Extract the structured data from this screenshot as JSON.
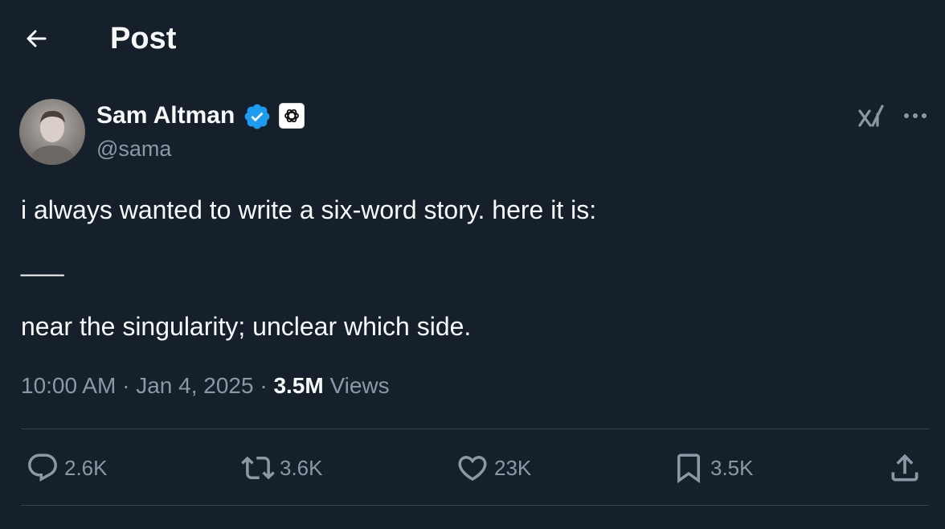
{
  "header": {
    "title": "Post",
    "back_icon": "arrow-left-icon"
  },
  "author": {
    "display_name": "Sam Altman",
    "handle": "@sama",
    "verified_icon": "verified-badge-icon",
    "affiliate_icon": "openai-logo-icon",
    "colors": {
      "verified": "#1d9bf0"
    }
  },
  "toolbar": {
    "grok_icon": "grok-icon",
    "more_icon": "more-horizontal-icon"
  },
  "post": {
    "line1": "i always wanted to write a six-word story. here it is:",
    "line2": "___",
    "line3": "near the singularity; unclear which side."
  },
  "meta": {
    "time": "10:00 AM",
    "sep1": " · ",
    "date": "Jan 4, 2025",
    "sep2": " · ",
    "views_count": "3.5M",
    "views_label": " Views"
  },
  "actions": {
    "replies": "2.6K",
    "reposts": "3.6K",
    "likes": "23K",
    "bookmarks": "3.5K"
  },
  "theme": {
    "background": "#15202b",
    "text": "#f7f9f9",
    "muted": "#8b98a5",
    "divider": "#38444d"
  }
}
